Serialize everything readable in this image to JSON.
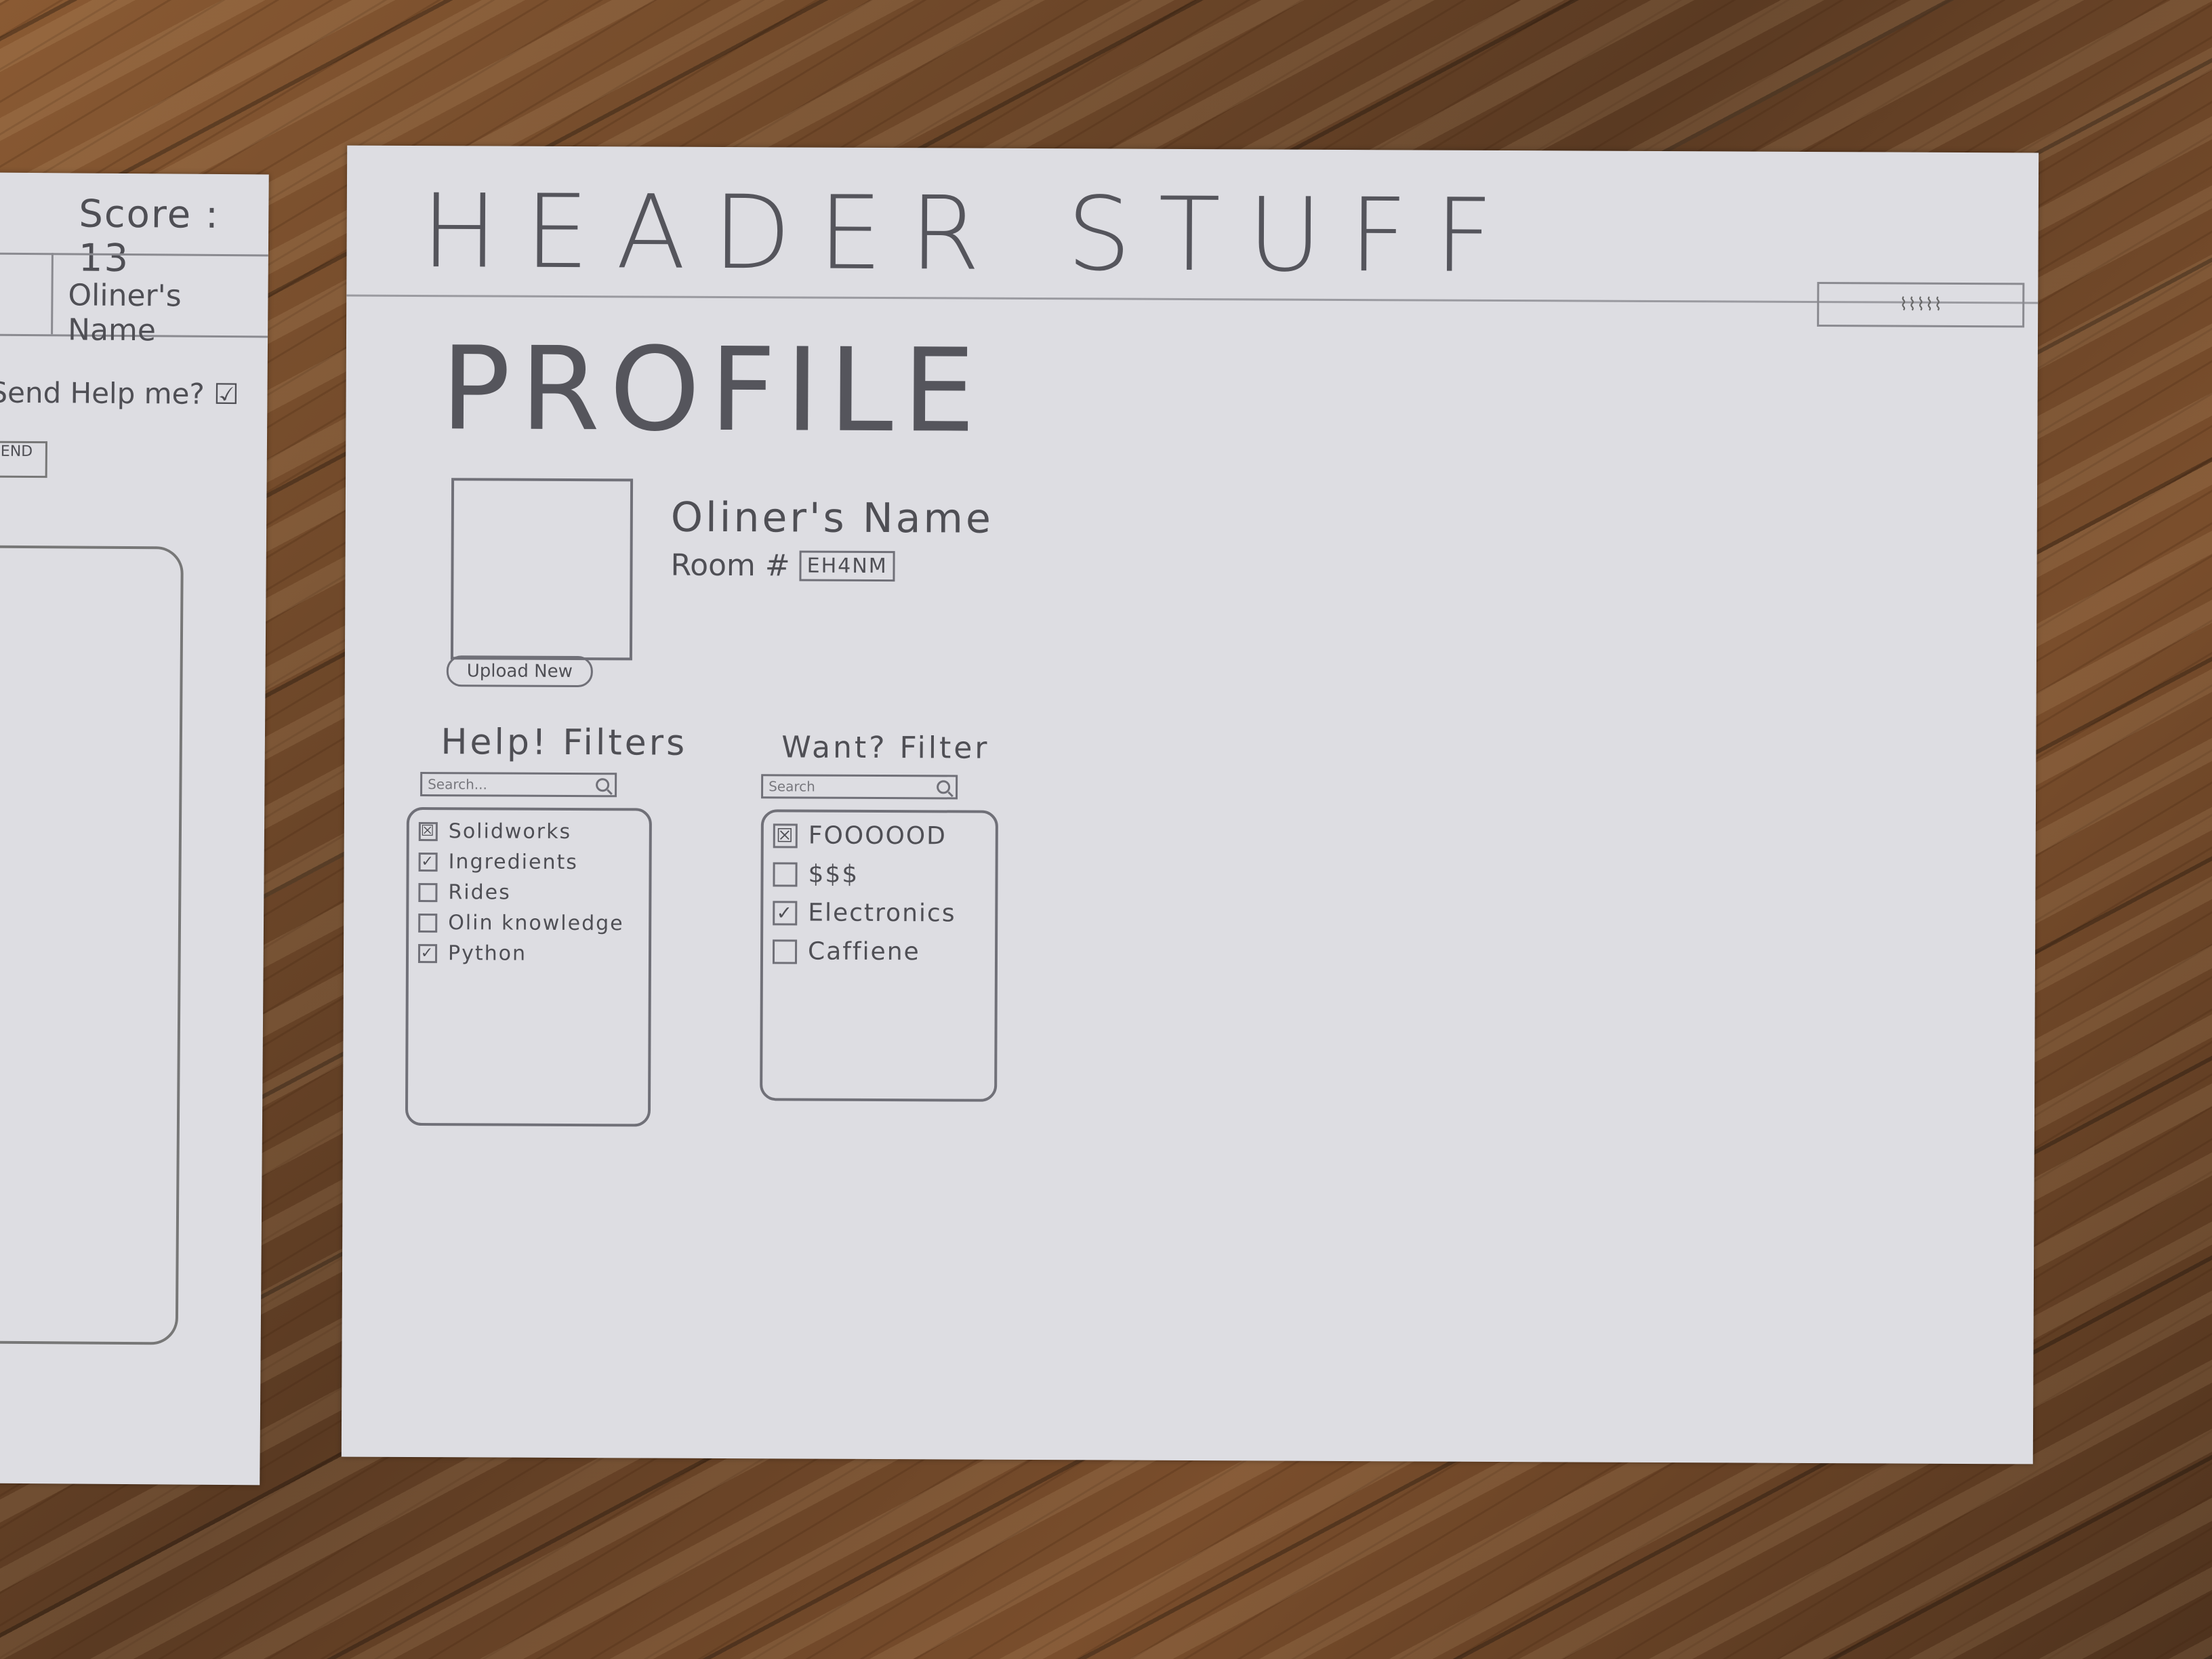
{
  "left_sheet": {
    "score": "Score : 13",
    "user_name": "Oliner's Name",
    "send_help": "Send Help me? ☑",
    "send_button": "SEND"
  },
  "header": {
    "text": "HEADER STUFF"
  },
  "page": {
    "title": "PROFILE"
  },
  "profile": {
    "upload_label": "Upload New",
    "name": "Oliner's Name",
    "room_label": "Room #",
    "room_value": "EH4NM"
  },
  "help_filters": {
    "title": "Help! Filters",
    "search_placeholder": "Search...",
    "items": [
      {
        "label": "Solidworks",
        "mark": "☒"
      },
      {
        "label": "Ingredients",
        "mark": "✓"
      },
      {
        "label": "Rides",
        "mark": ""
      },
      {
        "label": "Olin knowledge",
        "mark": ""
      },
      {
        "label": "Python",
        "mark": "✓"
      }
    ]
  },
  "want_filters": {
    "title": "Want? Filter",
    "search_placeholder": "Search",
    "items": [
      {
        "label": "FOOOOOD",
        "mark": "☒"
      },
      {
        "label": "$$$",
        "mark": ""
      },
      {
        "label": "Electronics",
        "mark": "✓"
      },
      {
        "label": "Caffiene",
        "mark": ""
      }
    ]
  }
}
